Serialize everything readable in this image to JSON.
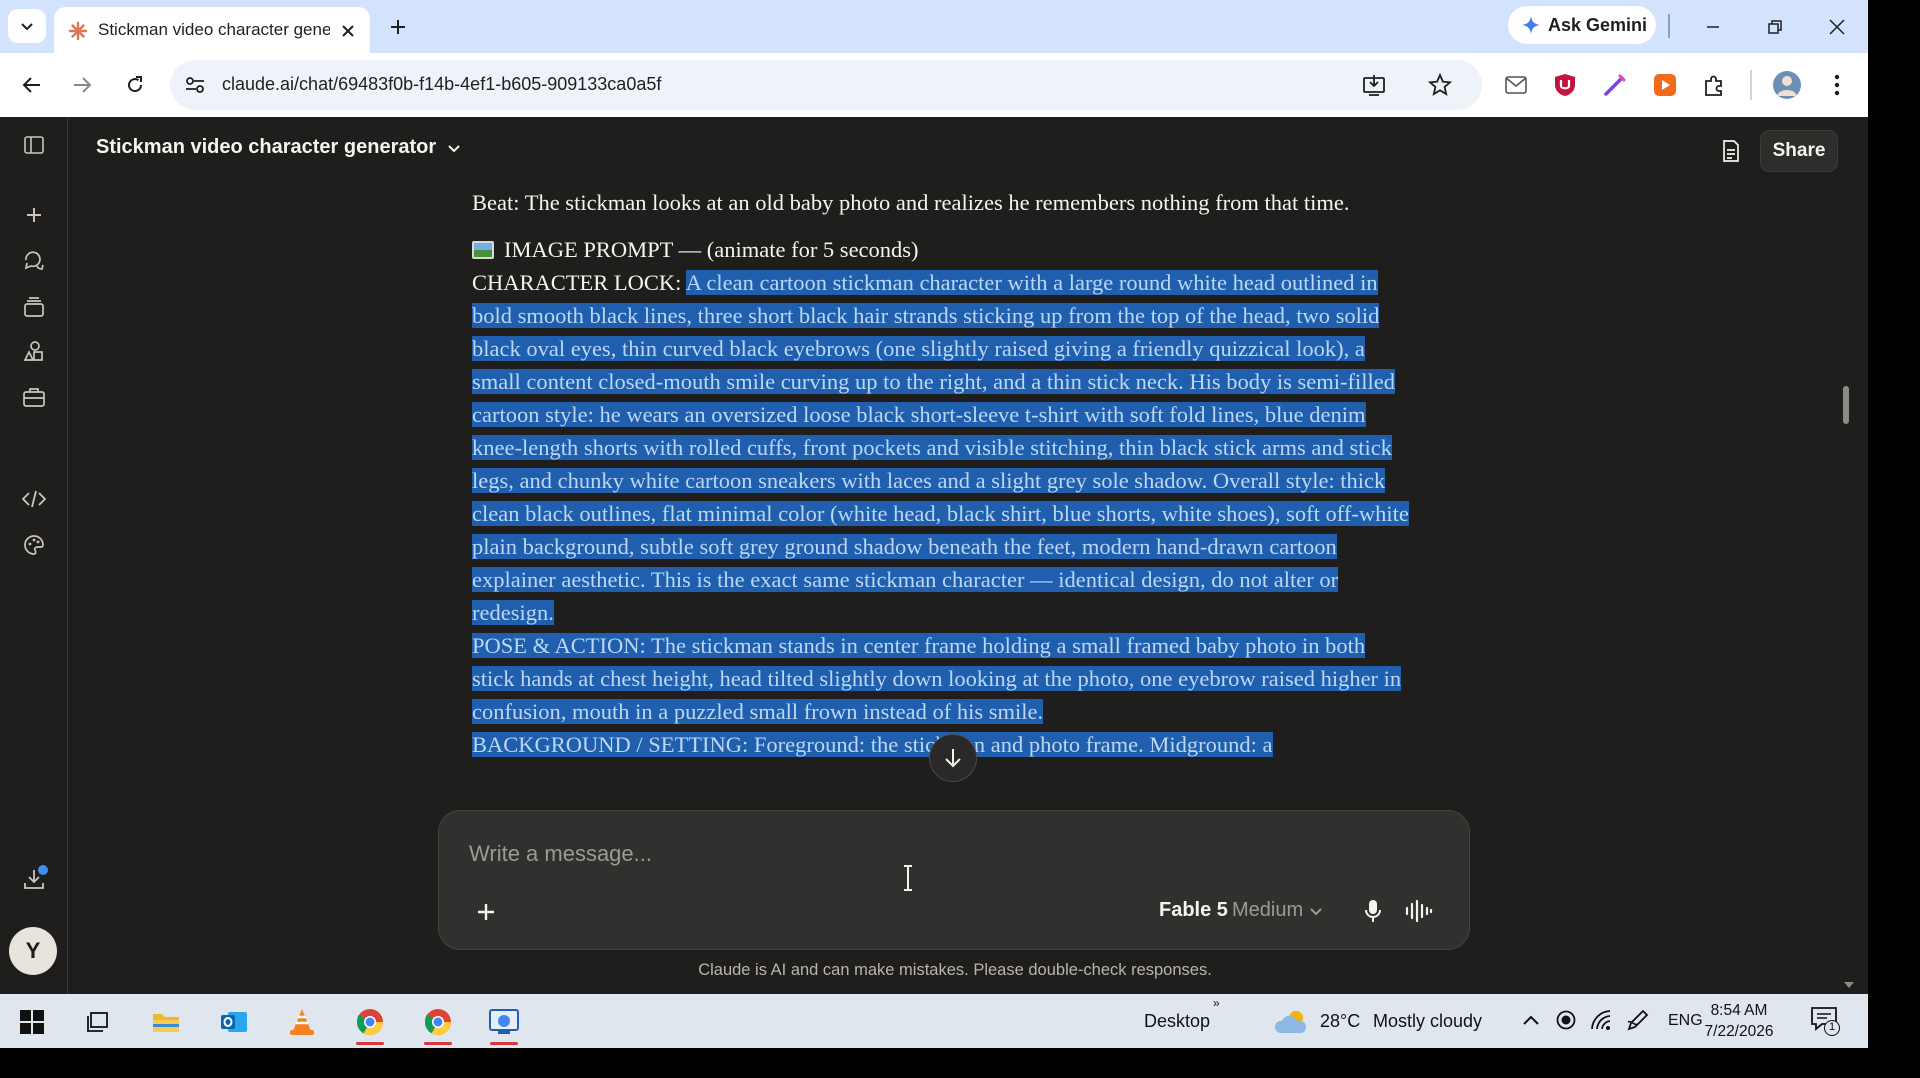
{
  "browser": {
    "tab_title": "Stickman video character gene",
    "url": "claude.ai/chat/69483f0b-f14b-4ef1-b605-909133ca0a5f",
    "ask_gemini": "Ask Gemini"
  },
  "app": {
    "chat_title": "Stickman video character generator",
    "share_label": "Share",
    "avatar_initial": "Y"
  },
  "message": {
    "beat": "Beat: The stickman looks at an old baby photo and realizes he remembers nothing from that time.",
    "image_prompt_heading": "IMAGE PROMPT — (animate for 5 seconds)",
    "character_lock_label": "CHARACTER LOCK: ",
    "character_lock_text": "A clean cartoon stickman character with a large round white head outlined in bold smooth black lines, three short black hair strands sticking up from the top of the head, two solid black oval eyes, thin curved black eyebrows (one slightly raised giving a friendly quizzical look), a small content closed-mouth smile curving up to the right, and a thin stick neck. His body is semi-filled cartoon style: he wears an oversized loose black short-sleeve t-shirt with soft fold lines, blue denim knee-length shorts with rolled cuffs, front pockets and visible stitching, thin black stick arms and stick legs, and chunky white cartoon sneakers with laces and a slight grey sole shadow. Overall style: thick clean black outlines, flat minimal color (white head, black shirt, blue shorts, white shoes), soft off-white plain background, subtle soft grey ground shadow beneath the feet, modern hand-drawn cartoon explainer aesthetic. This is the exact same stickman character — identical design, do not alter or redesign.",
    "pose_action": "POSE & ACTION: The stickman stands in center frame holding a small framed baby photo in both stick hands at chest height, head tilted slightly down looking at the photo, one eyebrow raised higher in confusion, mouth in a puzzled small frown instead of his smile.",
    "background_partial": "BACKGROUND / SETTING: Foreground: the stickman and photo frame. Midground: a"
  },
  "composer": {
    "placeholder": "Write a message...",
    "model_name": "Fable 5",
    "effort": "Medium",
    "disclaimer": "Claude is AI and can make mistakes. Please double-check responses."
  },
  "taskbar": {
    "desktop_label": "Desktop",
    "temperature": "28°C",
    "weather": "Mostly cloudy",
    "language": "ENG",
    "time": "8:54 AM",
    "date": "7/22/2026",
    "notification_count": "1"
  },
  "colors": {
    "app_bg": "#1f1e1d",
    "selection_bg": "#1f5fae",
    "selection_text": "#bcd7f6",
    "tabstrip_bg": "#d3e3fd",
    "taskbar_bg": "#dfe6ee",
    "claude_orange": "#d97757"
  }
}
